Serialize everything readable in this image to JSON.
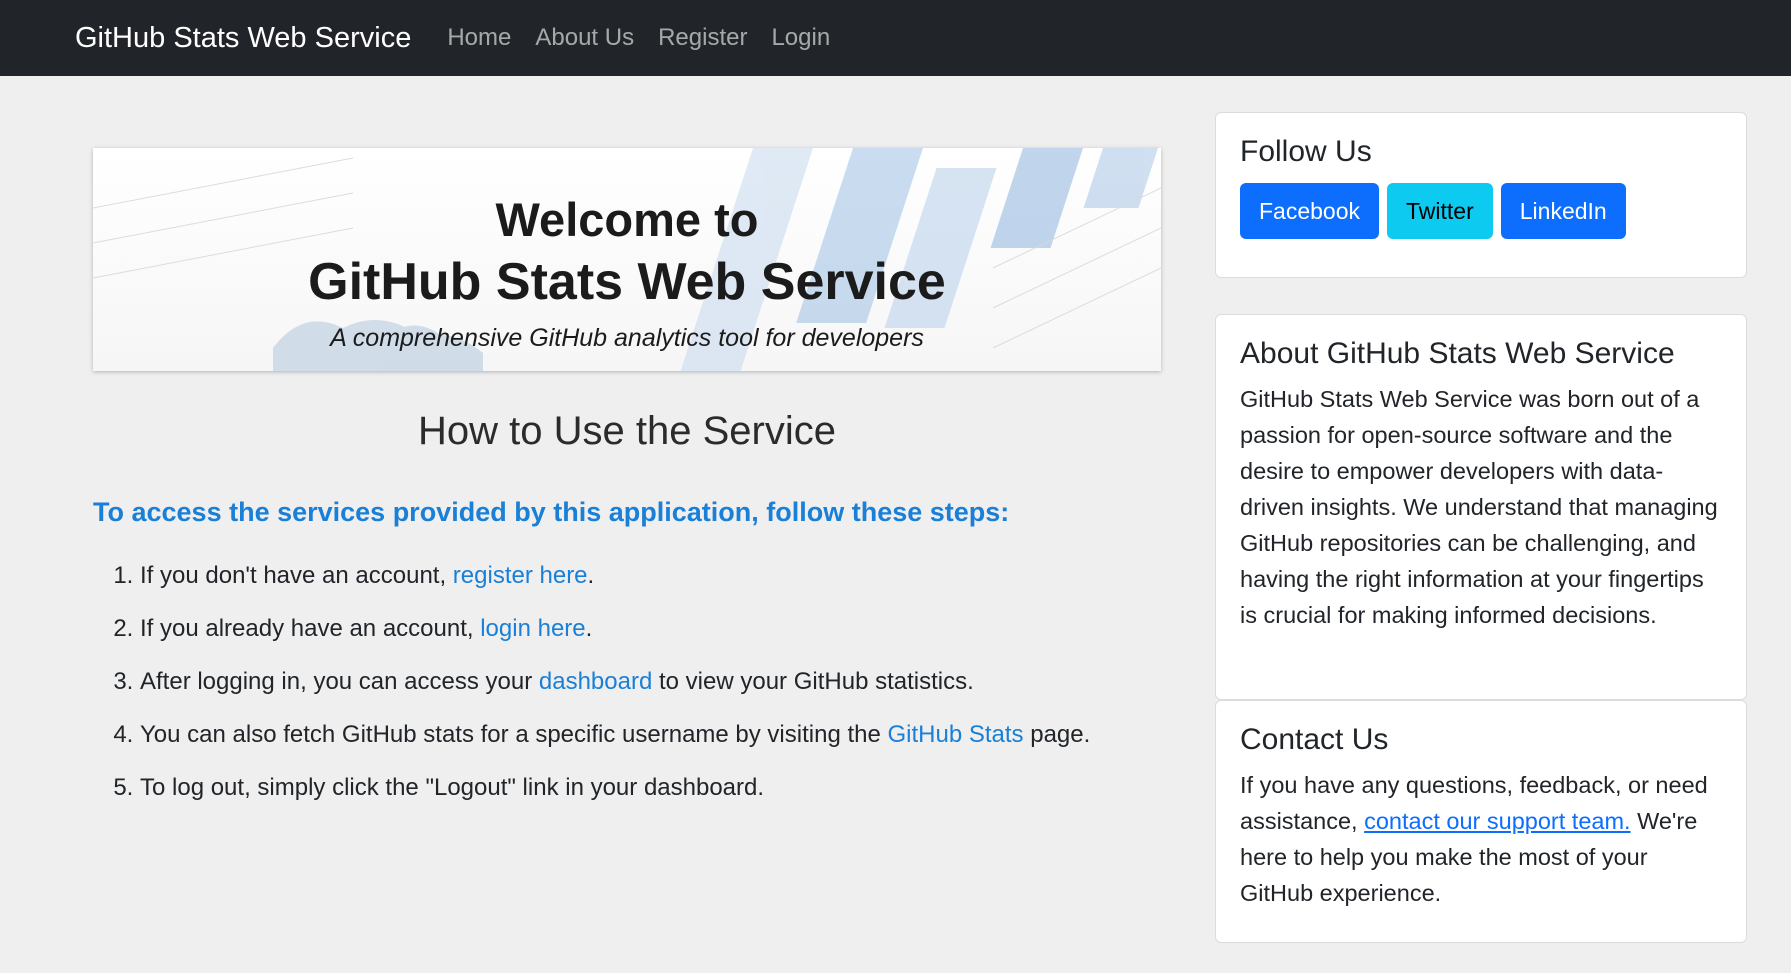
{
  "navbar": {
    "brand": "GitHub Stats Web Service",
    "links": [
      "Home",
      "About Us",
      "Register",
      "Login"
    ]
  },
  "banner": {
    "title_line1": "Welcome to",
    "title_line2": "GitHub Stats Web Service",
    "subtitle": "A comprehensive GitHub analytics tool for developers"
  },
  "how": {
    "title": "How to Use the Service",
    "intro": "To access the services provided by this application, follow these steps:",
    "steps": [
      {
        "pre": "If you don't have an account, ",
        "link": "register here",
        "post": "."
      },
      {
        "pre": "If you already have an account, ",
        "link": "login here",
        "post": "."
      },
      {
        "pre": "After logging in, you can access your ",
        "link": "dashboard",
        "post": " to view your GitHub statistics."
      },
      {
        "pre": "You can also fetch GitHub stats for a specific username by visiting the ",
        "link": "GitHub Stats",
        "post": " page."
      },
      {
        "pre": "To log out, simply click the \"Logout\" link in your dashboard.",
        "link": "",
        "post": ""
      }
    ]
  },
  "follow": {
    "title": "Follow Us",
    "buttons": [
      "Facebook",
      "Twitter",
      "LinkedIn"
    ]
  },
  "about": {
    "title": "About GitHub Stats Web Service",
    "text": "GitHub Stats Web Service was born out of a passion for open-source software and the desire to empower developers with data-driven insights. We understand that managing GitHub repositories can be challenging, and having the right information at your fingertips is crucial for making informed decisions."
  },
  "contact": {
    "title": "Contact Us",
    "text_pre": "If you have any questions, feedback, or need assistance, ",
    "link": "contact our support team.",
    "text_post": " We're here to help you make the most of your GitHub experience."
  },
  "colors": {
    "navbar": "#212529",
    "accent_link": "#1a7fd6",
    "btn_primary": "#0d6efd",
    "btn_info": "#0dcaf0"
  }
}
